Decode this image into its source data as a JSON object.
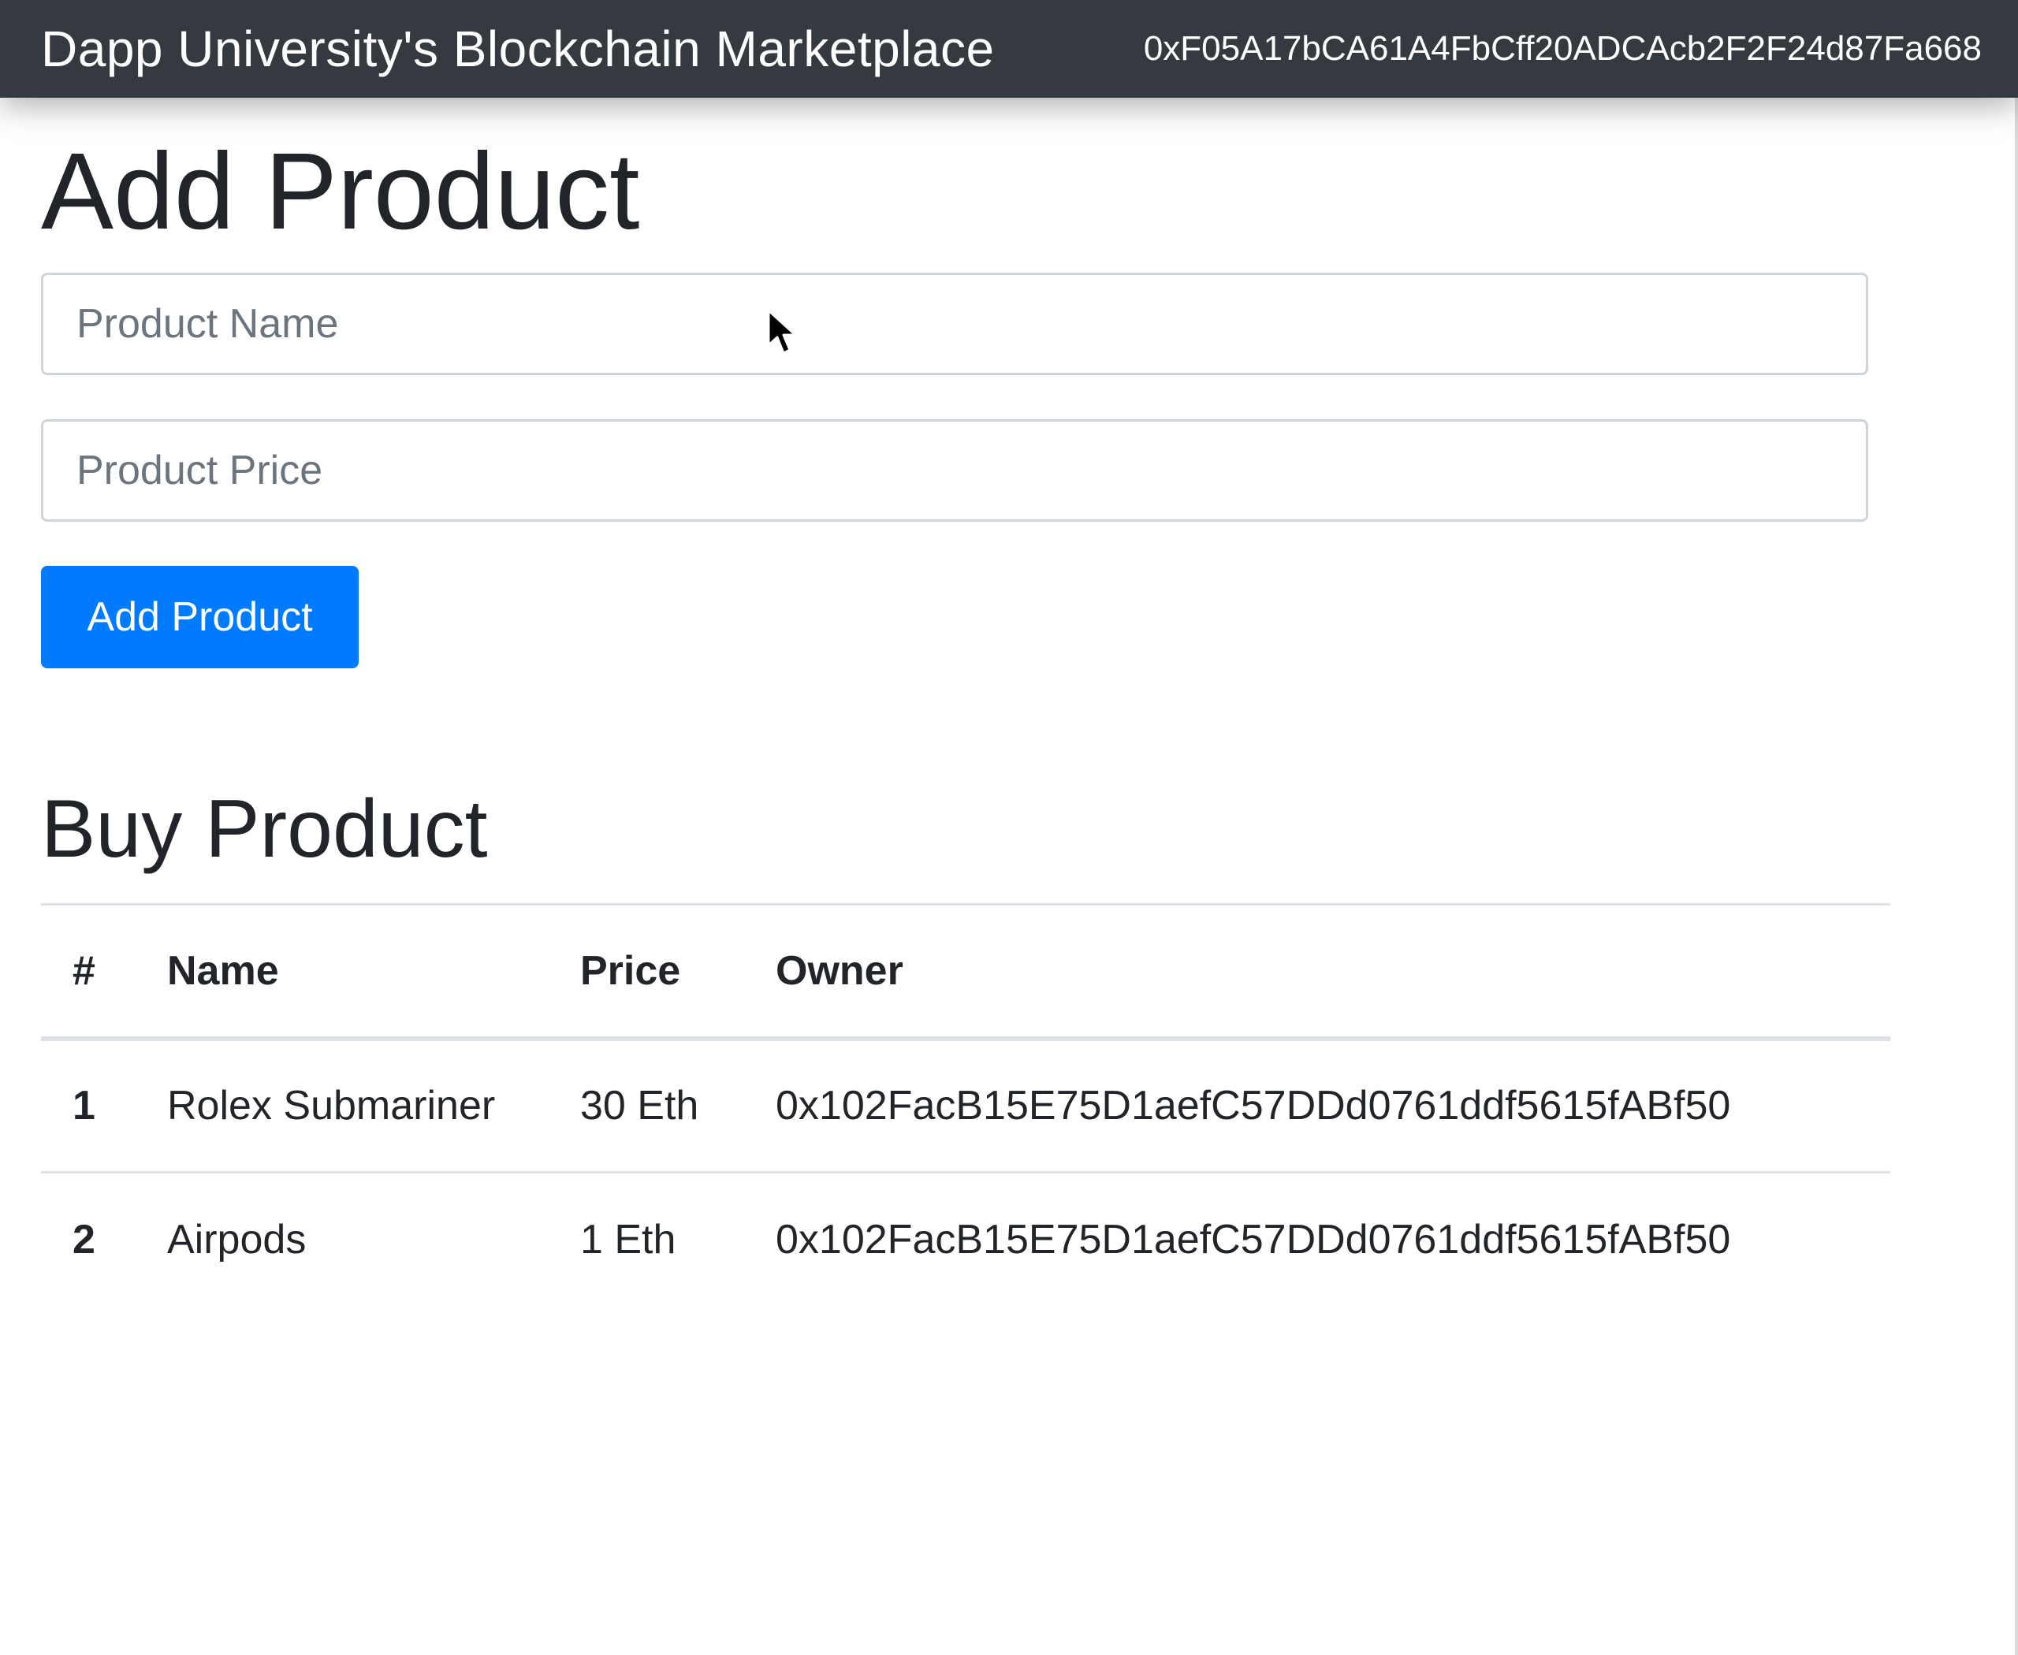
{
  "navbar": {
    "brand": "Dapp University's Blockchain Marketplace",
    "account": "0xF05A17bCA61A4FbCff20ADCAcb2F2F24d87Fa668"
  },
  "add_product": {
    "heading": "Add Product",
    "name_placeholder": "Product Name",
    "name_value": "",
    "price_placeholder": "Product Price",
    "price_value": "",
    "button_label": "Add Product"
  },
  "buy_product": {
    "heading": "Buy Product",
    "columns": [
      "#",
      "Name",
      "Price",
      "Owner"
    ],
    "rows": [
      {
        "id": "1",
        "name": "Rolex Submariner",
        "price": "30 Eth",
        "owner": "0x102FacB15E75D1aefC57DDd0761ddf5615fABf50"
      },
      {
        "id": "2",
        "name": "Airpods",
        "price": "1 Eth",
        "owner": "0x102FacB15E75D1aefC57DDd0761ddf5615fABf50"
      }
    ]
  },
  "colors": {
    "navbar_bg": "#343a40",
    "primary": "#007bff",
    "text": "#212529"
  }
}
